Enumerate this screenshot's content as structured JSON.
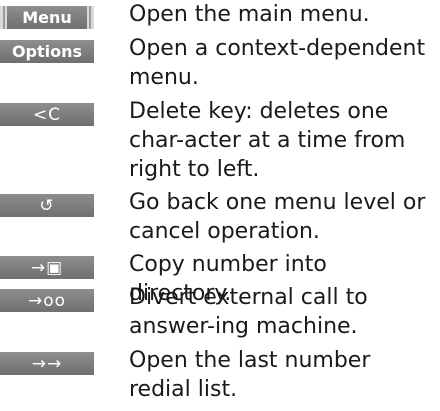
{
  "keys": [
    {
      "label": "Menu",
      "icon": "menu-softkey",
      "description": "Open the main menu."
    },
    {
      "label": "Options",
      "icon": "options-softkey",
      "description": "Open a context-dependent menu."
    },
    {
      "label": "<C",
      "icon": "delete-key-icon",
      "description": "Delete key: deletes one char-acter at a time from right to left."
    },
    {
      "label": "↺",
      "icon": "back-arrow-icon",
      "description": "Go back one menu level or cancel operation."
    },
    {
      "label": "→▣",
      "icon": "copy-to-directory-icon",
      "description": "Copy number into directory."
    },
    {
      "label": "→oo",
      "icon": "answering-machine-icon",
      "description": "Divert external call to answer-ing machine."
    },
    {
      "label": "→→",
      "icon": "redial-list-icon",
      "description": "Open the last number redial list."
    }
  ]
}
